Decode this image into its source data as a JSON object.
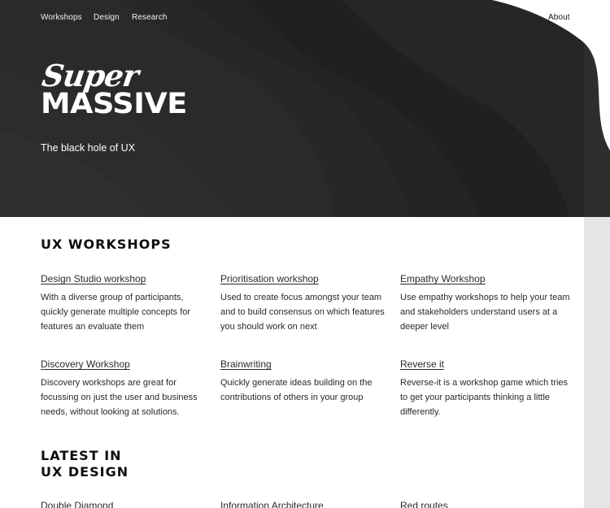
{
  "nav": {
    "left": [
      "Workshops",
      "Design",
      "Research"
    ],
    "about": "About"
  },
  "hero": {
    "logo_script": "Super",
    "logo_bold": "MASSIVE",
    "tagline": "The black hole of UX"
  },
  "workshops": {
    "heading": "UX WORKSHOPS",
    "items": [
      {
        "title": "Design Studio workshop",
        "desc": "With a diverse group of participants, quickly generate multiple concepts for features an evaluate them"
      },
      {
        "title": "Prioritisation workshop",
        "desc": "Used to create focus amongst your team and to build consensus on which features you should work on next"
      },
      {
        "title": "Empathy Workshop",
        "desc": "Use empathy workshops to help your team and stakeholders understand users at a deeper level"
      },
      {
        "title": "Discovery Workshop",
        "desc": "Discovery workshops are great for focussing on just the user and business needs, without looking at solutions."
      },
      {
        "title": "Brainwriting",
        "desc": "Quickly generate ideas building on the contributions of others in your group"
      },
      {
        "title": "Reverse it",
        "desc": "Reverse-it is a workshop game which tries to get your participants thinking a little differently."
      }
    ]
  },
  "latest": {
    "heading_line1": "LATEST IN",
    "heading_line2": "UX DESIGN",
    "items": [
      {
        "title": "Double Diamond"
      },
      {
        "title": "Information Architecture"
      },
      {
        "title": "Red routes"
      }
    ]
  }
}
